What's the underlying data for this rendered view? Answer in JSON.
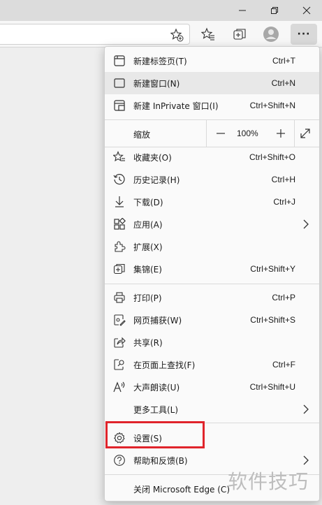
{
  "window": {
    "minimize_glyph": "—",
    "restore_glyph": "❐",
    "close_glyph": "✕"
  },
  "toolbar": {
    "more_glyph": "···"
  },
  "menu": {
    "items": [
      {
        "id": "new-tab",
        "label": "新建标签页(T)",
        "shortcut": "Ctrl+T",
        "icon": "new-tab-icon"
      },
      {
        "id": "new-window",
        "label": "新建窗口(N)",
        "shortcut": "Ctrl+N",
        "icon": "new-window-icon"
      },
      {
        "id": "new-inprivate",
        "label": "新建 InPrivate 窗口(I)",
        "shortcut": "Ctrl+Shift+N",
        "icon": "inprivate-icon"
      },
      {
        "id": "favorites",
        "label": "收藏夹(O)",
        "shortcut": "Ctrl+Shift+O",
        "icon": "favorites-icon"
      },
      {
        "id": "history",
        "label": "历史记录(H)",
        "shortcut": "Ctrl+H",
        "icon": "history-icon"
      },
      {
        "id": "downloads",
        "label": "下载(D)",
        "shortcut": "Ctrl+J",
        "icon": "download-icon"
      },
      {
        "id": "apps",
        "label": "应用(A)",
        "shortcut": "",
        "icon": "apps-icon"
      },
      {
        "id": "extensions",
        "label": "扩展(X)",
        "shortcut": "",
        "icon": "extensions-icon"
      },
      {
        "id": "collections",
        "label": "集锦(E)",
        "shortcut": "Ctrl+Shift+Y",
        "icon": "collections-icon"
      },
      {
        "id": "print",
        "label": "打印(P)",
        "shortcut": "Ctrl+P",
        "icon": "print-icon"
      },
      {
        "id": "web-capture",
        "label": "网页捕获(W)",
        "shortcut": "Ctrl+Shift+S",
        "icon": "web-capture-icon"
      },
      {
        "id": "share",
        "label": "共享(R)",
        "shortcut": "",
        "icon": "share-icon"
      },
      {
        "id": "find",
        "label": "在页面上查找(F)",
        "shortcut": "Ctrl+F",
        "icon": "find-icon"
      },
      {
        "id": "read-aloud",
        "label": "大声朗读(U)",
        "shortcut": "Ctrl+Shift+U",
        "icon": "read-aloud-icon"
      },
      {
        "id": "more-tools",
        "label": "更多工具(L)",
        "shortcut": "",
        "icon": ""
      },
      {
        "id": "settings",
        "label": "设置(S)",
        "shortcut": "",
        "icon": "gear-icon"
      },
      {
        "id": "help",
        "label": "帮助和反馈(B)",
        "shortcut": "",
        "icon": "help-icon"
      },
      {
        "id": "close-edge",
        "label": "关闭 Microsoft Edge (C)",
        "shortcut": "",
        "icon": ""
      }
    ],
    "zoom": {
      "label": "缩放",
      "minus": "—",
      "value": "100%",
      "plus": "+"
    }
  },
  "watermark": "软件技巧",
  "colors": {
    "highlight_box": "#e0242b"
  }
}
